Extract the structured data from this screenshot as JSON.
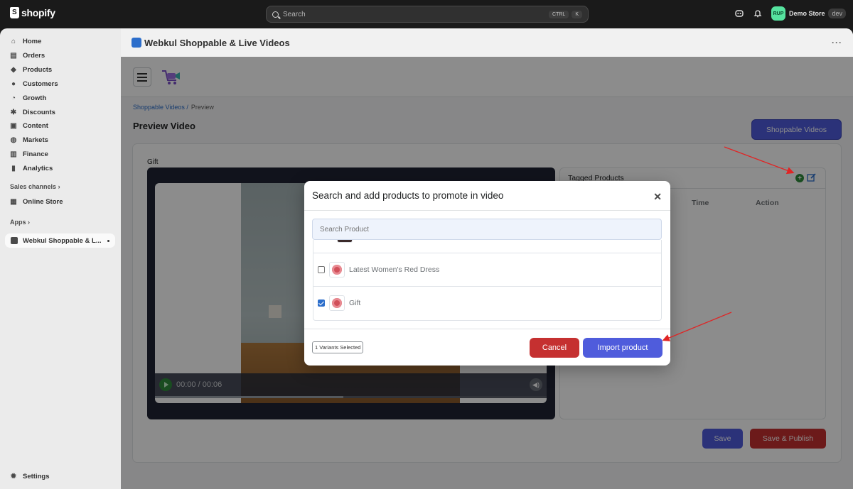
{
  "topbar": {
    "brand": "shopify",
    "search_placeholder": "Search",
    "shortcut_keys": [
      "CTRL",
      "K"
    ],
    "store_initials": "RUP",
    "store_name": "Demo Store",
    "store_badge": "dev"
  },
  "sidebar": {
    "items": [
      {
        "label": "Home",
        "icon": "home-icon"
      },
      {
        "label": "Orders",
        "icon": "inbox-icon"
      },
      {
        "label": "Products",
        "icon": "tag-icon"
      },
      {
        "label": "Customers",
        "icon": "person-icon"
      },
      {
        "label": "Growth",
        "icon": "gauge-icon"
      },
      {
        "label": "Discounts",
        "icon": "discount-icon"
      },
      {
        "label": "Content",
        "icon": "content-icon"
      },
      {
        "label": "Markets",
        "icon": "globe-icon"
      },
      {
        "label": "Finance",
        "icon": "bank-icon"
      },
      {
        "label": "Analytics",
        "icon": "chart-icon"
      }
    ],
    "sales_channels_label": "Sales channels",
    "online_store_label": "Online Store",
    "apps_label": "Apps",
    "active_app_label": "Webkul Shoppable & L...",
    "settings_label": "Settings"
  },
  "app": {
    "title": "Webkul Shoppable & Live Videos",
    "breadcrumb_link": "Shoppable Videos /",
    "breadcrumb_current": "Preview",
    "page_title": "Preview Video",
    "shoppable_button": "Shoppable Videos",
    "video_title": "Gift",
    "time_display": "00:00 / 00:06",
    "tagged_title": "Tagged Products",
    "col_time": "Time",
    "col_action": "Action",
    "save_button": "Save",
    "save_publish_button": "Save & Publish"
  },
  "modal": {
    "title": "Search and add products to promote in video",
    "search_placeholder": "Search Product",
    "products": [
      {
        "name": "Latest Women's Red Dress",
        "checked": false
      },
      {
        "name": "Gift",
        "checked": true
      }
    ],
    "variants_selected": "1 Variants Selected",
    "cancel_button": "Cancel",
    "import_button": "Import product"
  },
  "colors": {
    "primary": "#4f5cdc",
    "danger": "#c53030",
    "success": "#2e8b3b",
    "annotation_arrow": "#e02424"
  }
}
